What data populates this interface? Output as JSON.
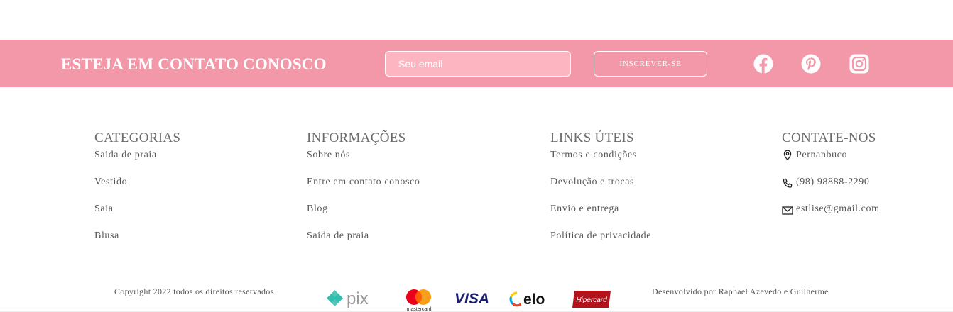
{
  "newsletter": {
    "title": "ESTEJA EM CONTATO CONOSCO",
    "email_placeholder": "Seu email",
    "subscribe_label": "INSCREVER-SE",
    "background_color": "#f398a8",
    "social": [
      "facebook-icon",
      "pinterest-icon",
      "instagram-icon"
    ]
  },
  "columns": {
    "categorias": {
      "title": "CATEGORIAS",
      "items": [
        "Saida de praia",
        "Vestido",
        "Saia",
        "Blusa"
      ]
    },
    "informacoes": {
      "title": "INFORMAÇÕES",
      "items": [
        "Sobre nós",
        "Entre em contato conosco",
        "Blog",
        "Saida de praia"
      ]
    },
    "links": {
      "title": "LINKS ÚTEIS",
      "items": [
        "Termos e condições",
        "Devolução e trocas",
        "Envio e entrega",
        "Política de privacidade"
      ]
    },
    "contato": {
      "title": "CONTATE-NOS",
      "items": [
        {
          "icon": "location-pin-icon",
          "text": "Pernanbuco"
        },
        {
          "icon": "phone-icon",
          "text": "(98) 98888-2290"
        },
        {
          "icon": "mail-icon",
          "text": "estlise@gmail.com"
        }
      ]
    }
  },
  "footer": {
    "copyright": "Copyright 2022 todos os direitos reservados",
    "credits": "Desenvolvido por Raphael Azevedo e Guilherme",
    "payments": {
      "pix": "pix",
      "mastercard": "mastercard",
      "visa": "VISA",
      "elo": "elo",
      "hipercard": "Hipercard"
    }
  }
}
